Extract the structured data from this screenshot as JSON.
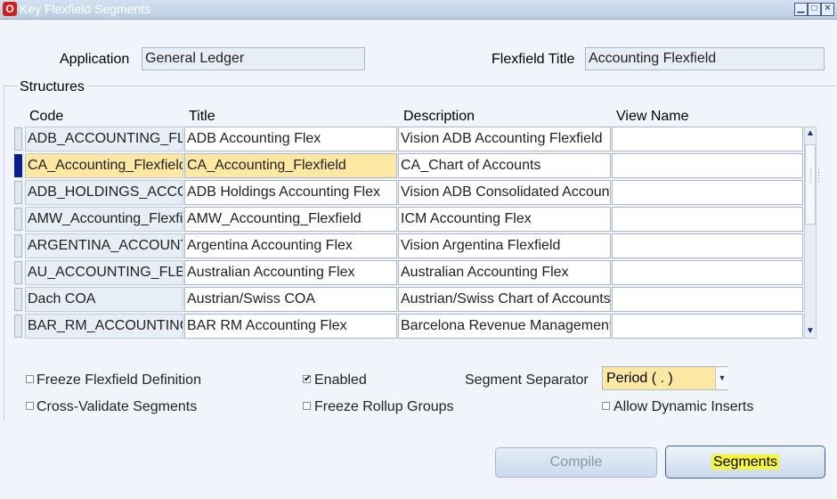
{
  "window": {
    "title": "Key Flexfield Segments",
    "icon": "oracle-app-icon",
    "icon_glyph": "O",
    "controls": {
      "minimize": "▁",
      "maximize": "□",
      "close": "✕"
    }
  },
  "header": {
    "application_label": "Application",
    "application_value": "General Ledger",
    "flexfield_title_label": "Flexfield Title",
    "flexfield_title_value": "Accounting Flexfield"
  },
  "structures": {
    "legend": "Structures",
    "columns": [
      "Code",
      "Title",
      "Description",
      "View Name"
    ],
    "current_row": 1,
    "rows": [
      {
        "code": "ADB_ACCOUNTING_FLEX",
        "title": "ADB Accounting Flex",
        "description": "Vision ADB Accounting Flexfield",
        "view_name": ""
      },
      {
        "code": "CA_Accounting_Flexfield",
        "title": "CA_Accounting_Flexfield",
        "description": "CA_Chart of Accounts",
        "view_name": ""
      },
      {
        "code": "ADB_HOLDINGS_ACCOUNTING",
        "title": "ADB Holdings Accounting Flex",
        "description": "Vision ADB Consolidated Accounting",
        "view_name": ""
      },
      {
        "code": "AMW_Accounting_Flexfield",
        "title": "AMW_Accounting_Flexfield",
        "description": "ICM Accounting Flex",
        "view_name": ""
      },
      {
        "code": "ARGENTINA_ACCOUNTING",
        "title": "Argentina Accounting Flex",
        "description": "Vision Argentina Flexfield",
        "view_name": ""
      },
      {
        "code": "AU_ACCOUNTING_FLEX",
        "title": "Australian Accounting Flex",
        "description": "Australian Accounting Flex",
        "view_name": ""
      },
      {
        "code": "Dach COA",
        "title": "Austrian/Swiss COA",
        "description": "Austrian/Swiss Chart of Accounts",
        "view_name": ""
      },
      {
        "code": "BAR_RM_ACCOUNTING",
        "title": "BAR RM Accounting Flex",
        "description": "Barcelona Revenue Management",
        "view_name": ""
      }
    ]
  },
  "options": {
    "freeze_definition": {
      "label": "Freeze Flexfield Definition",
      "checked": false
    },
    "cross_validate": {
      "label": "Cross-Validate Segments",
      "checked": false
    },
    "enabled": {
      "label": "Enabled",
      "checked": true,
      "mark": "✔"
    },
    "freeze_rollup": {
      "label": "Freeze Rollup Groups",
      "checked": false
    },
    "allow_dynamic_inserts": {
      "label": "Allow Dynamic Inserts",
      "checked": false
    },
    "segment_separator_label": "Segment Separator",
    "segment_separator_value": "Period ( . )"
  },
  "buttons": {
    "compile": "Compile",
    "segments": "Segments"
  },
  "colors": {
    "background": "#f1f5fb",
    "highlight_row": "#fce8a2",
    "current_record": "#0a1f8e",
    "segments_highlight": "#f5f53c"
  }
}
